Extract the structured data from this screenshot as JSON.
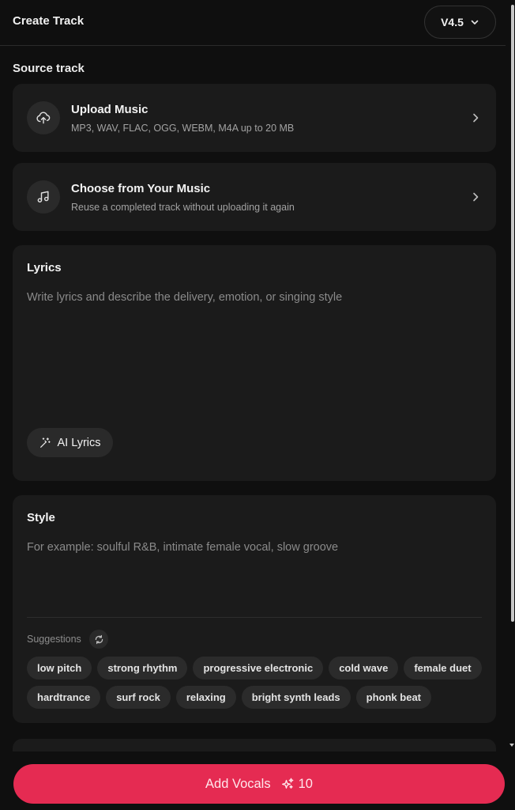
{
  "header": {
    "title": "Create Track",
    "version": "V4.5"
  },
  "source": {
    "label": "Source track",
    "upload": {
      "title": "Upload Music",
      "subtitle": "MP3, WAV, FLAC, OGG, WEBM, M4A up to 20 MB"
    },
    "choose": {
      "title": "Choose from Your Music",
      "subtitle": "Reuse a completed track without uploading it again"
    }
  },
  "lyrics": {
    "title": "Lyrics",
    "value": "",
    "placeholder": "Write lyrics and describe the delivery, emotion, or singing style",
    "ai_button": "AI Lyrics"
  },
  "style": {
    "title": "Style",
    "value": "",
    "placeholder": "For example: soulful R&B, intimate female vocal, slow groove",
    "suggestions_label": "Suggestions",
    "suggestions": [
      "low pitch",
      "strong rhythm",
      "progressive electronic",
      "cold wave",
      "female duet",
      "hardtrance",
      "surf rock",
      "relaxing",
      "bright synth leads",
      "phonk beat"
    ]
  },
  "cta": {
    "label": "Add Vocals",
    "credits": "10"
  },
  "colors": {
    "accent": "#e52b52",
    "background": "#0f0f0f",
    "card": "#1b1b1b",
    "chip": "#2b2b2b"
  },
  "icons": {
    "version_dropdown": "chevron-down-icon",
    "upload": "cloud-upload-icon",
    "choose": "music-note-icon",
    "card_arrow": "chevron-right-icon",
    "ai_lyrics": "magic-wand-icon",
    "refresh": "refresh-icon",
    "credits": "sparkle-icon"
  }
}
